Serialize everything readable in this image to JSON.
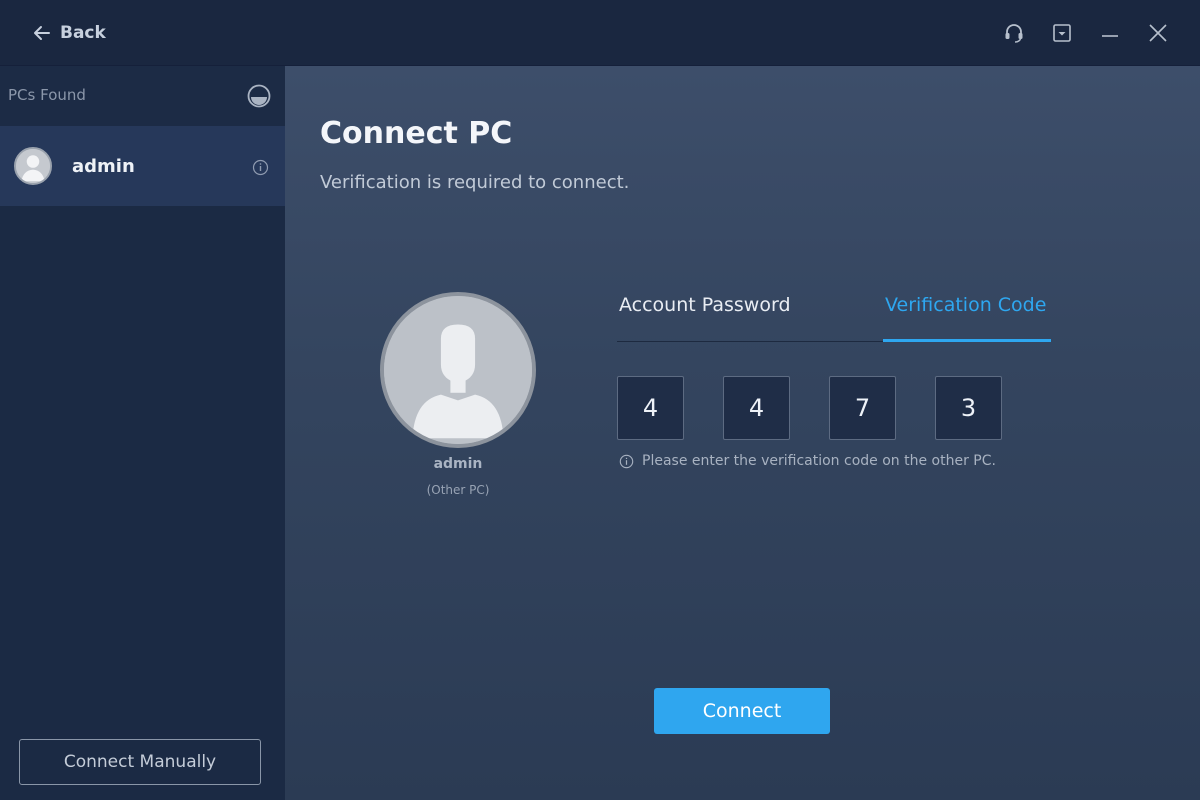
{
  "titlebar": {
    "back_label": "Back",
    "icons": [
      "support-icon",
      "minimize-to-tray-icon",
      "minimize-icon",
      "close-icon"
    ]
  },
  "sidebar": {
    "header_label": "PCs Found",
    "items": [
      {
        "name": "admin",
        "icon": "avatar"
      }
    ],
    "connect_manually_label": "Connect Manually"
  },
  "main": {
    "title": "Connect PC",
    "subtitle": "Verification is required to connect.",
    "remote": {
      "name": "admin",
      "sub": "(Other PC)"
    },
    "tabs": [
      {
        "label": "Account Password",
        "active": false
      },
      {
        "label": "Verification Code",
        "active": true
      }
    ],
    "code_digits": [
      "4",
      "4",
      "7",
      "3"
    ],
    "hint": "Please enter the verification code on the other PC.",
    "connect_label": "Connect"
  },
  "colors": {
    "accent": "#2ea7f0",
    "sidebar_bg": "#1b2a44",
    "main_bg": "#3d4e6a"
  }
}
